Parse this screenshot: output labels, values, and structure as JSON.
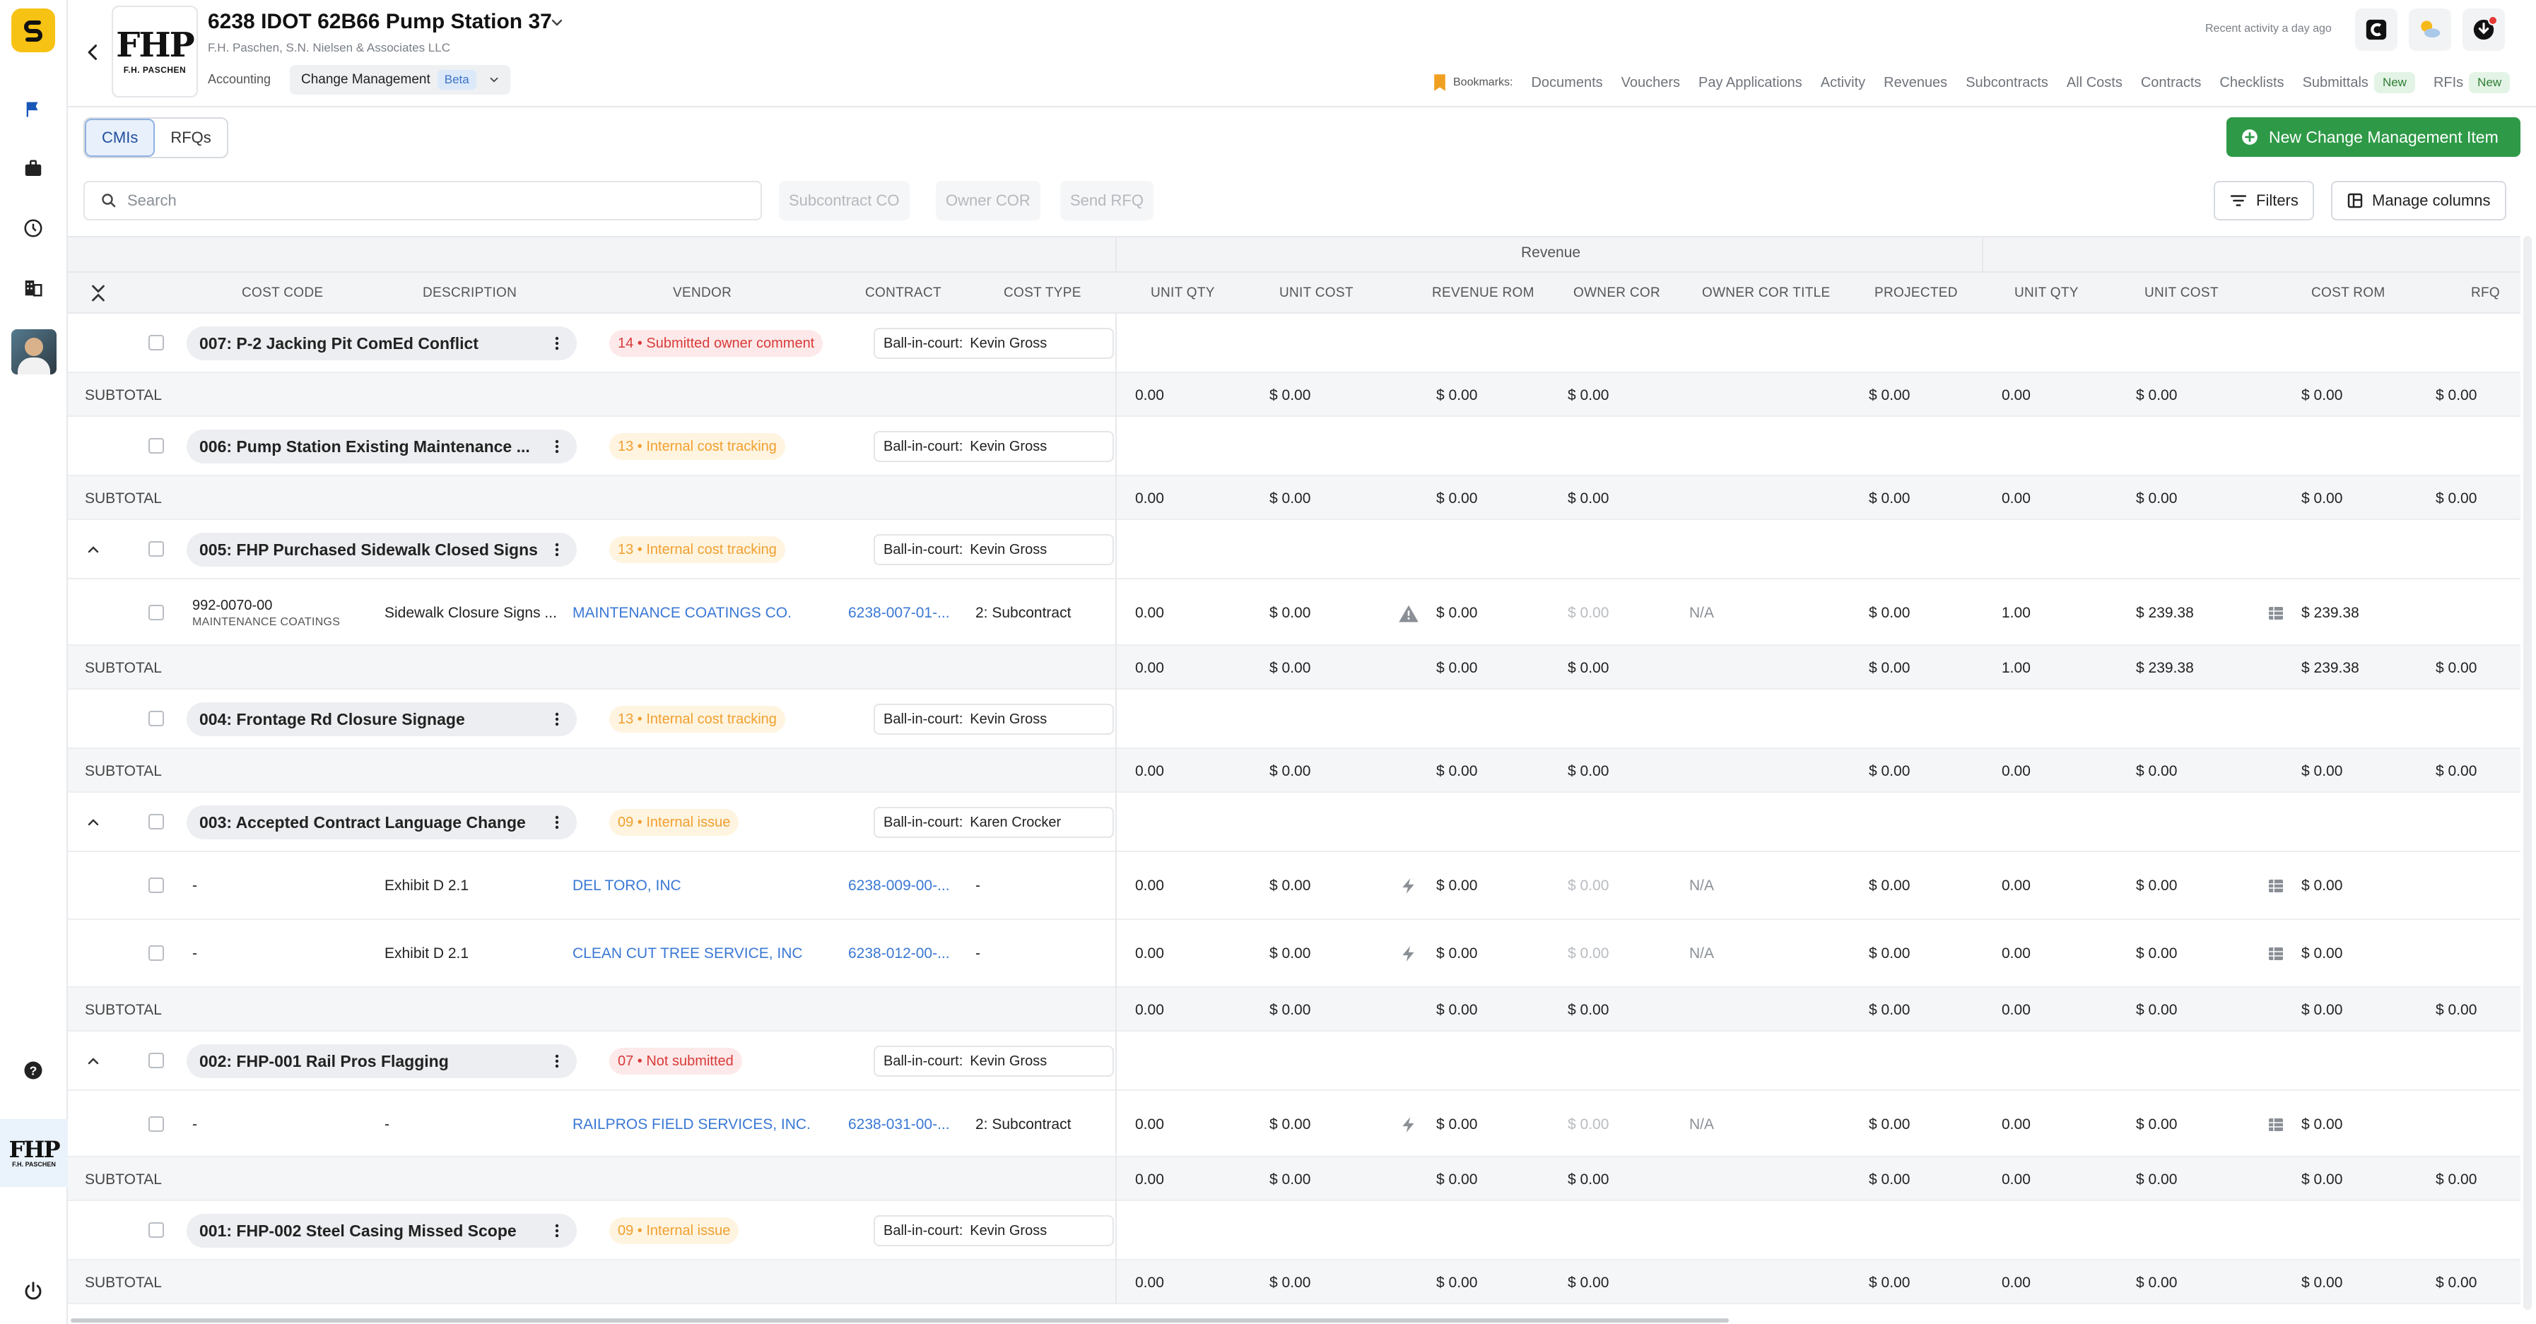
{
  "header": {
    "project_title": "6238 IDOT 62B66 Pump Station 37",
    "project_sub": "F.H. Paschen, S.N. Nielsen & Associates LLC",
    "logo_big": "FHP",
    "logo_small": "F.H. PASCHEN",
    "accounting": "Accounting",
    "module": "Change Management",
    "beta": "Beta",
    "recent": "Recent activity a day ago",
    "bookmarks_label": "Bookmarks:",
    "bookmarks": [
      "Documents",
      "Vouchers",
      "Pay Applications",
      "Activity",
      "Revenues",
      "Subcontracts",
      "All Costs",
      "Contracts",
      "Checklists",
      "Submittals",
      "RFIs"
    ],
    "new_label": "New"
  },
  "rail": {
    "company_logo": "FHP",
    "company_small": "F.H. PASCHEN"
  },
  "tabs": {
    "cmis": "CMIs",
    "rfqs": "RFQs"
  },
  "actions": {
    "new_cmi": "New Change Management Item"
  },
  "toolbar": {
    "search_placeholder": "Search",
    "subcontract_co": "Subcontract CO",
    "owner_cor": "Owner COR",
    "send_rfq": "Send RFQ",
    "filters": "Filters",
    "manage_columns": "Manage columns"
  },
  "table": {
    "group_revenue": "Revenue",
    "columns": {
      "cost_code": "COST CODE",
      "description": "DESCRIPTION",
      "vendor": "VENDOR",
      "contract": "CONTRACT",
      "cost_type": "COST TYPE",
      "unit_qty": "UNIT QTY",
      "unit_cost": "UNIT COST",
      "revenue_rom": "REVENUE ROM",
      "owner_cor": "OWNER COR",
      "owner_cor_title": "OWNER COR TITLE",
      "projected": "PROJECTED",
      "unit_qty2": "UNIT QTY",
      "unit_cost2": "UNIT COST",
      "cost_rom": "COST ROM",
      "rfq": "RFQ"
    },
    "ball_label": "Ball-in-court:",
    "subtotal_label": "SUBTOTAL",
    "cmi": [
      {
        "name": "007: P-2 Jacking Pit ComEd Conflict",
        "status": "14 • Submitted owner comment",
        "ball": "Kevin Gross"
      },
      {
        "name": "006: Pump Station Existing Maintenance ...",
        "status": "13 • Internal cost tracking",
        "ball": "Kevin Gross"
      },
      {
        "name": "005: FHP Purchased Sidewalk Closed Signs",
        "status": "13 • Internal cost tracking",
        "ball": "Kevin Gross"
      },
      {
        "name": "004: Frontage Rd Closure Signage",
        "status": "13 • Internal cost tracking",
        "ball": "Kevin Gross"
      },
      {
        "name": "003: Accepted Contract Language Change",
        "status": "09 • Internal issue",
        "ball": "Karen Crocker"
      },
      {
        "name": "002: FHP-001 Rail Pros Flagging",
        "status": "07 • Not submitted",
        "ball": "Kevin Gross"
      },
      {
        "name": "001: FHP-002 Steel Casing Missed Scope",
        "status": "09 • Internal issue",
        "ball": "Kevin Gross"
      }
    ],
    "lines": [
      {
        "code": "992-0070-00",
        "code_sub": "MAINTENANCE COATINGS",
        "description": "Sidewalk Closure Signs ...",
        "vendor": "MAINTENANCE COATINGS CO.",
        "contract": "6238-007-01-...",
        "cost_type": "2: Subcontract",
        "unit_qty": "0.00",
        "unit_cost": "$ 0.00",
        "revenue_rom": "$ 0.00",
        "owner_cor": "$ 0.00",
        "owner_cor_title": "N/A",
        "projected": "$ 0.00",
        "unit_qty2": "1.00",
        "unit_cost2": "$ 239.38",
        "cost_rom": "$ 239.38"
      },
      {
        "code": "-",
        "code_sub": "",
        "description": "Exhibit D 2.1",
        "vendor": "DEL TORO, INC",
        "contract": "6238-009-00-...",
        "cost_type": "-",
        "unit_qty": "0.00",
        "unit_cost": "$ 0.00",
        "revenue_rom": "$ 0.00",
        "owner_cor": "$ 0.00",
        "owner_cor_title": "N/A",
        "projected": "$ 0.00",
        "unit_qty2": "0.00",
        "unit_cost2": "$ 0.00",
        "cost_rom": "$ 0.00"
      },
      {
        "code": "-",
        "code_sub": "",
        "description": "Exhibit D 2.1",
        "vendor": "CLEAN CUT TREE SERVICE, INC",
        "contract": "6238-012-00-...",
        "cost_type": "-",
        "unit_qty": "0.00",
        "unit_cost": "$ 0.00",
        "revenue_rom": "$ 0.00",
        "owner_cor": "$ 0.00",
        "owner_cor_title": "N/A",
        "projected": "$ 0.00",
        "unit_qty2": "0.00",
        "unit_cost2": "$ 0.00",
        "cost_rom": "$ 0.00"
      },
      {
        "code": "-",
        "code_sub": "",
        "description": "-",
        "vendor": "RAILPROS FIELD SERVICES, INC.",
        "contract": "6238-031-00-...",
        "cost_type": "2: Subcontract",
        "unit_qty": "0.00",
        "unit_cost": "$ 0.00",
        "revenue_rom": "$ 0.00",
        "owner_cor": "$ 0.00",
        "owner_cor_title": "N/A",
        "projected": "$ 0.00",
        "unit_qty2": "0.00",
        "unit_cost2": "$ 0.00",
        "cost_rom": "$ 0.00"
      }
    ],
    "subtotals": [
      {
        "unit_qty": "0.00",
        "unit_cost": "$ 0.00",
        "revenue_rom": "$ 0.00",
        "owner_cor": "$ 0.00",
        "projected": "$ 0.00",
        "unit_qty2": "0.00",
        "unit_cost2": "$ 0.00",
        "cost_rom": "$ 0.00",
        "rfq": "$ 0.00"
      },
      {
        "unit_qty": "0.00",
        "unit_cost": "$ 0.00",
        "revenue_rom": "$ 0.00",
        "owner_cor": "$ 0.00",
        "projected": "$ 0.00",
        "unit_qty2": "0.00",
        "unit_cost2": "$ 0.00",
        "cost_rom": "$ 0.00",
        "rfq": "$ 0.00"
      },
      {
        "unit_qty": "0.00",
        "unit_cost": "$ 0.00",
        "revenue_rom": "$ 0.00",
        "owner_cor": "$ 0.00",
        "projected": "$ 0.00",
        "unit_qty2": "1.00",
        "unit_cost2": "$ 239.38",
        "cost_rom": "$ 239.38",
        "rfq": "$ 0.00"
      },
      {
        "unit_qty": "0.00",
        "unit_cost": "$ 0.00",
        "revenue_rom": "$ 0.00",
        "owner_cor": "$ 0.00",
        "projected": "$ 0.00",
        "unit_qty2": "0.00",
        "unit_cost2": "$ 0.00",
        "cost_rom": "$ 0.00",
        "rfq": "$ 0.00"
      },
      {
        "unit_qty": "0.00",
        "unit_cost": "$ 0.00",
        "revenue_rom": "$ 0.00",
        "owner_cor": "$ 0.00",
        "projected": "$ 0.00",
        "unit_qty2": "0.00",
        "unit_cost2": "$ 0.00",
        "cost_rom": "$ 0.00",
        "rfq": "$ 0.00"
      },
      {
        "unit_qty": "0.00",
        "unit_cost": "$ 0.00",
        "revenue_rom": "$ 0.00",
        "owner_cor": "$ 0.00",
        "projected": "$ 0.00",
        "unit_qty2": "0.00",
        "unit_cost2": "$ 0.00",
        "cost_rom": "$ 0.00",
        "rfq": "$ 0.00"
      },
      {
        "unit_qty": "0.00",
        "unit_cost": "$ 0.00",
        "revenue_rom": "$ 0.00",
        "owner_cor": "$ 0.00",
        "projected": "$ 0.00",
        "unit_qty2": "0.00",
        "unit_cost2": "$ 0.00",
        "cost_rom": "$ 0.00",
        "rfq": "$ 0.00"
      }
    ]
  },
  "colors": {
    "accent_green": "#2e9a47",
    "link_blue": "#3a78d4",
    "status_red": "#d93a3a",
    "status_orange": "#f0a030",
    "brand_yellow": "#f6c214"
  }
}
